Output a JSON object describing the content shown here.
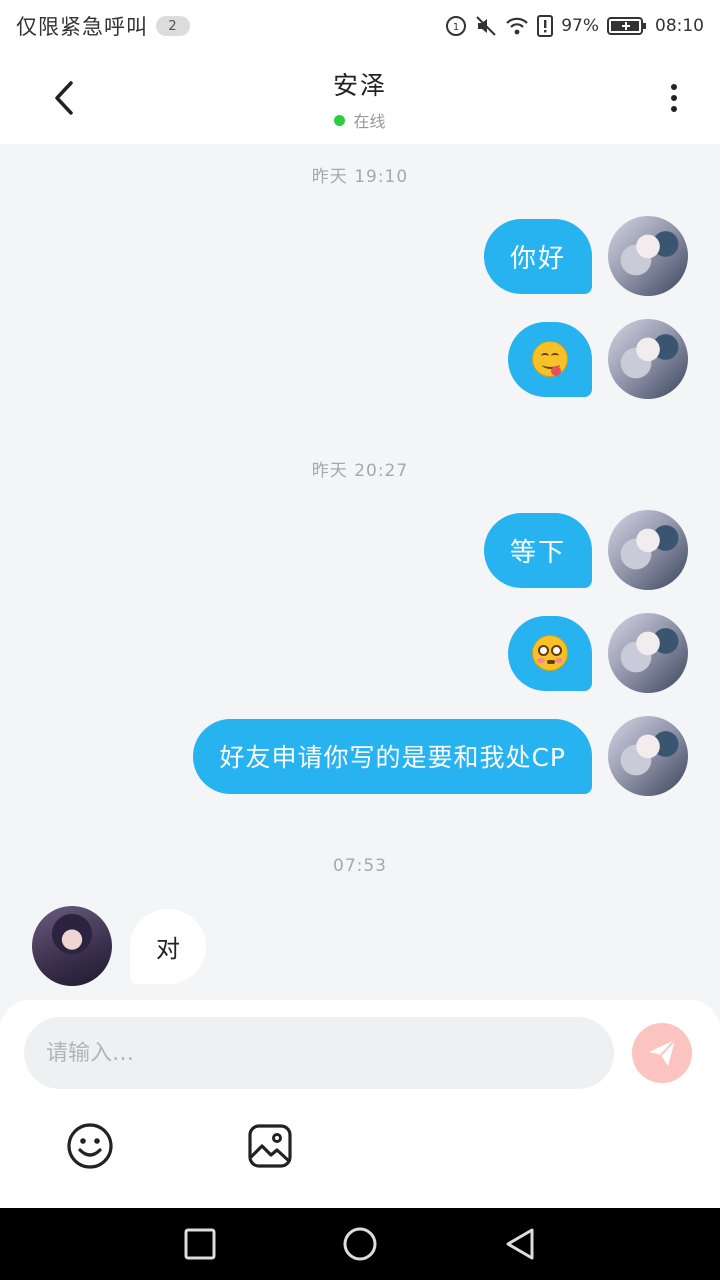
{
  "status_bar": {
    "emergency_text": "仅限紧急呼叫",
    "notification_count": "2",
    "battery": "97%",
    "time": "08:10"
  },
  "header": {
    "contact_name": "安泽",
    "status": "在线"
  },
  "chat": {
    "timestamps": [
      "昨天 19:10",
      "昨天 20:27",
      "07:53"
    ],
    "outgoing": [
      {
        "text": "你好"
      },
      {
        "emoji": "face-savoring-food"
      },
      {
        "text": "等下"
      },
      {
        "emoji": "flushed-face"
      },
      {
        "text": "好友申请你写的是要和我处CP"
      }
    ],
    "incoming": [
      {
        "text": "对"
      }
    ]
  },
  "composer": {
    "placeholder": "请输入…"
  },
  "colors": {
    "bubble_out": "#27b2f0",
    "send_button": "#fbc4c0",
    "online_dot": "#2ecc40"
  }
}
